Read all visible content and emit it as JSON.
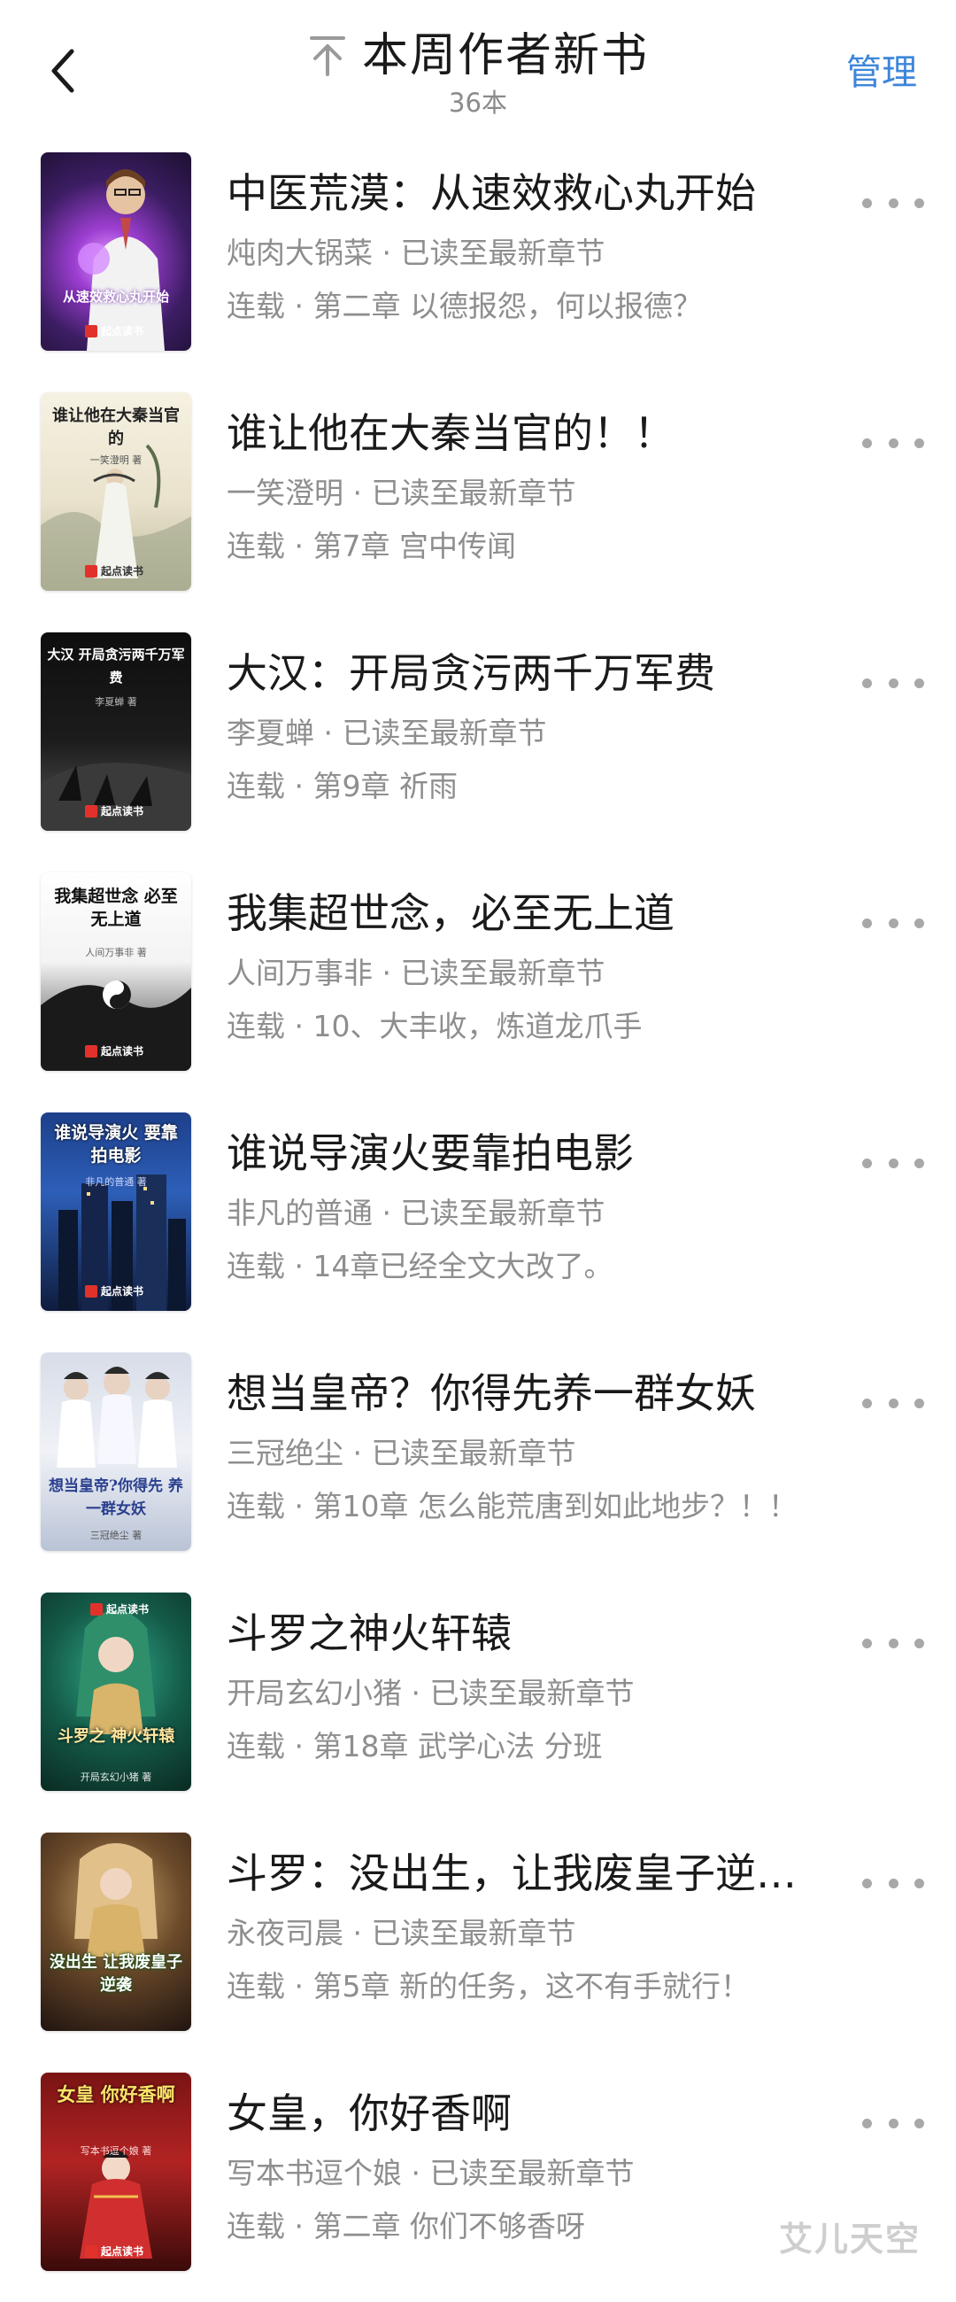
{
  "header": {
    "title": "本周作者新书",
    "count": "36本",
    "manage_label": "管理"
  },
  "colors": {
    "accent": "#3d86d9",
    "muted_text": "#8e8e8e",
    "more_dots": "#a8a8a8"
  },
  "icons": {
    "back": "chevron-left-icon",
    "pin": "pin-top-icon",
    "more": "more-horizontal-icon"
  },
  "books": [
    {
      "title": "中医荒漠：从速效救心丸开始",
      "meta": "炖肉大锅菜 · 已读至最新章节",
      "chapter": "连载 · 第二章 以德报怨，何以报德？",
      "cover_text": "从速效救心丸开始",
      "cover_author": "",
      "cover_brand": "起点读书"
    },
    {
      "title": "谁让他在大秦当官的！！",
      "meta": "一笑澄明 · 已读至最新章节",
      "chapter": "连载 · 第7章 宫中传闻",
      "cover_text": "谁让他在大秦当官的",
      "cover_author": "一笑澄明 著",
      "cover_brand": "起点读书"
    },
    {
      "title": "大汉：开局贪污两千万军费",
      "meta": "李夏蝉 · 已读至最新章节",
      "chapter": "连载 · 第9章 祈雨",
      "cover_text": "大汉 开局贪污两千万军费",
      "cover_author": "李夏蝉 著",
      "cover_brand": "起点读书"
    },
    {
      "title": "我集超世念，必至无上道",
      "meta": "人间万事非 · 已读至最新章节",
      "chapter": "连载 · 10、大丰收，炼道龙爪手",
      "cover_text": "我集超世念 必至无上道",
      "cover_author": "人间万事非 著",
      "cover_brand": "起点读书"
    },
    {
      "title": "谁说导演火要靠拍电影",
      "meta": "非凡的普通 · 已读至最新章节",
      "chapter": "连载 · 14章已经全文大改了。",
      "cover_text": "谁说导演火 要靠拍电影",
      "cover_author": "非凡的普通 著",
      "cover_brand": "起点读书"
    },
    {
      "title": "想当皇帝？你得先养一群女妖",
      "meta": "三冠绝尘 · 已读至最新章节",
      "chapter": "连载 · 第10章 怎么能荒唐到如此地步？！！",
      "cover_text": "想当皇帝?你得先 养一群女妖",
      "cover_author": "三冠绝尘 著",
      "cover_brand": "起点读书"
    },
    {
      "title": "斗罗之神火轩辕",
      "meta": "开局玄幻小猪 · 已读至最新章节",
      "chapter": "连载 · 第18章 武学心法 分班",
      "cover_text": "斗罗之 神火轩辕",
      "cover_author": "开局玄幻小猪 著",
      "cover_brand": "起点读书"
    },
    {
      "title": "斗罗：没出生，让我废皇子逆…",
      "meta": "永夜司晨 · 已读至最新章节",
      "chapter": "连载 · 第5章 新的任务，这不有手就行！",
      "cover_text": "没出生 让我废皇子 逆袭",
      "cover_author": "",
      "cover_brand": "起点读书"
    },
    {
      "title": "女皇，你好香啊",
      "meta": "写本书逗个娘 · 已读至最新章节",
      "chapter": "连载 · 第二章 你们不够香呀",
      "cover_text": "女皇 你好香啊",
      "cover_author": "写本书逗个娘 著",
      "cover_brand": "起点读书"
    }
  ],
  "watermark": "艾儿天空"
}
